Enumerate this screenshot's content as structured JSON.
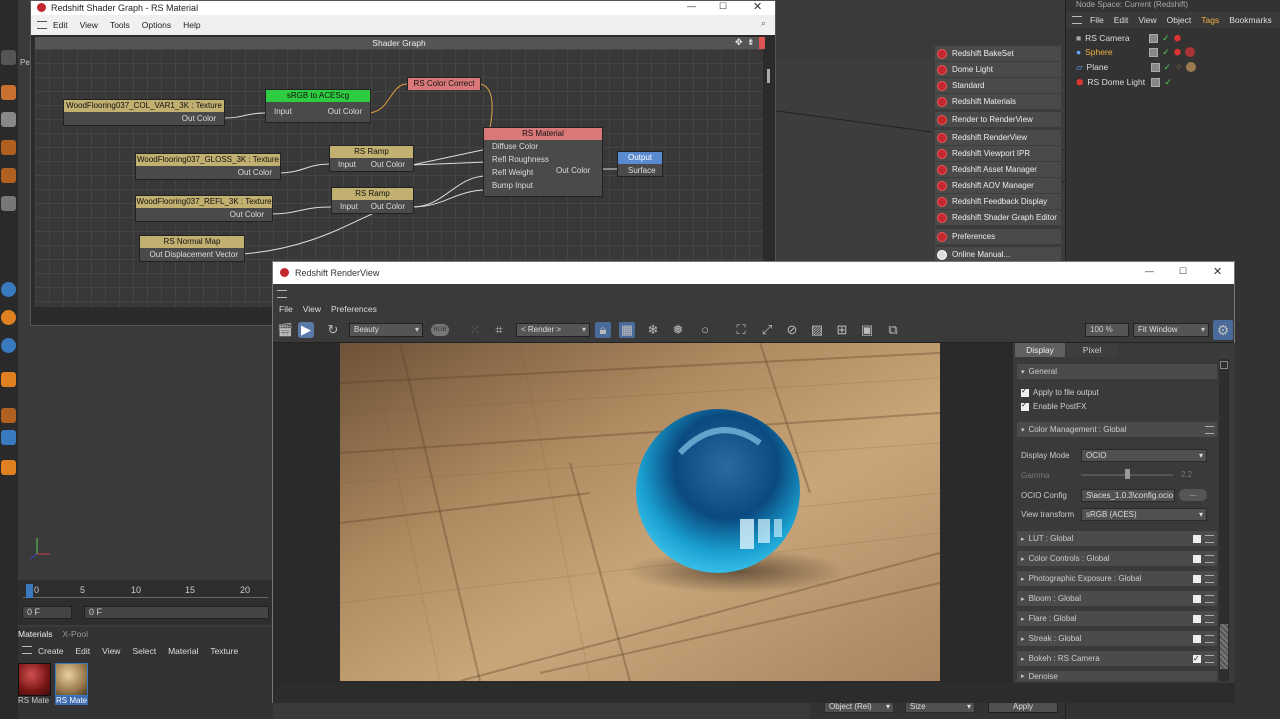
{
  "shader_graph": {
    "window_title": "Redshift Shader Graph - RS Material",
    "menu": [
      "Edit",
      "View",
      "Tools",
      "Options",
      "Help"
    ],
    "panel_title": "Shader Graph",
    "nodes": {
      "col_texture": {
        "title": "WoodFlooring037_COL_VAR1_3K : Texture",
        "out": "Out Color"
      },
      "srgb": {
        "title": "sRGB to ACEScg",
        "in": "Input",
        "out": "Out Color"
      },
      "color_correct": {
        "title": "RS Color Correct"
      },
      "gloss_texture": {
        "title": "WoodFlooring037_GLOSS_3K : Texture",
        "out": "Out Color"
      },
      "ramp1": {
        "title": "RS Ramp",
        "in": "Input",
        "out": "Out Color"
      },
      "refl_texture": {
        "title": "WoodFlooring037_REFL_3K : Texture",
        "out": "Out Color"
      },
      "ramp2": {
        "title": "RS Ramp",
        "in": "Input",
        "out": "Out Color"
      },
      "normal_map": {
        "title": "RS Normal Map",
        "out": "Out Displacement Vector"
      },
      "material": {
        "title": "RS Material",
        "inputs": [
          "Diffuse Color",
          "Refl Roughness",
          "Refl Weight",
          "Bump Input"
        ],
        "out": "Out Color"
      },
      "output": {
        "title": "Output",
        "in": "Surface"
      }
    }
  },
  "object_manager": {
    "header": "Node Space: Current (Redshift)",
    "menu": [
      "File",
      "Edit",
      "View",
      "Object",
      "Tags",
      "Bookmarks"
    ],
    "active_menu": "Tags",
    "objects": [
      "RS Camera",
      "Sphere",
      "Plane",
      "RS Dome Light"
    ]
  },
  "redshift_menu": {
    "items": [
      "Redshift BakeSet",
      "Dome Light",
      "Standard",
      "Redshift Materials",
      "Render to RenderView",
      "Redshift RenderView",
      "Redshift Viewport IPR",
      "Redshift Asset Manager",
      "Redshift AOV Manager",
      "Redshift Feedback Display",
      "Redshift Shader Graph Editor",
      "Preferences",
      "Online Manual..."
    ]
  },
  "render_view": {
    "window_title": "Redshift RenderView",
    "menu": [
      "File",
      "View",
      "Preferences"
    ],
    "aov_select": "Beauty",
    "rgb_label": "RGB",
    "render_select": "< Render >",
    "zoom": "100 %",
    "fit_select": "Fit Window",
    "tabs": [
      "Display",
      "Pixel"
    ],
    "active_tab": "Display",
    "general": {
      "title": "General",
      "apply_file_output": "Apply to file output",
      "enable_postfx": "Enable PostFX"
    },
    "color_management": {
      "title": "Color Management  : Global",
      "display_mode_label": "Display Mode",
      "display_mode": "OCIO",
      "gamma_label": "Gamma",
      "gamma_value": "2.2",
      "gamma_fraction": 0.5,
      "ocio_config_label": "OCIO Config",
      "ocio_config": "S\\aces_1.0.3\\config.ocio",
      "browse": "...",
      "view_transform_label": "View transform",
      "view_transform": "sRGB (ACES)"
    },
    "sections": [
      {
        "title": "LUT  : Global",
        "checked": false
      },
      {
        "title": "Color Controls  : Global",
        "checked": false
      },
      {
        "title": "Photographic Exposure  : Global",
        "checked": false
      },
      {
        "title": "Bloom  : Global",
        "checked": false
      },
      {
        "title": "Flare  : Global",
        "checked": false
      },
      {
        "title": "Streak  : Global",
        "checked": false
      },
      {
        "title": "Bokeh  : RS Camera",
        "checked": true
      },
      {
        "title": "Denoise",
        "checked": false
      }
    ]
  },
  "timeline": {
    "ticks": [
      "0",
      "5",
      "10",
      "15",
      "20"
    ],
    "frame_a": "0 F",
    "frame_b": "0 F"
  },
  "materials": {
    "tabs": [
      "Materials",
      "X-Pool"
    ],
    "menu": [
      "Create",
      "Edit",
      "View",
      "Select",
      "Material",
      "Texture"
    ],
    "items": [
      "RS Mate",
      "RS Mate"
    ]
  },
  "attributes_bottom": {
    "object_rel": "Object (Rel)",
    "size": "Size",
    "apply": "Apply"
  },
  "left_panel": {
    "label": "Per"
  }
}
